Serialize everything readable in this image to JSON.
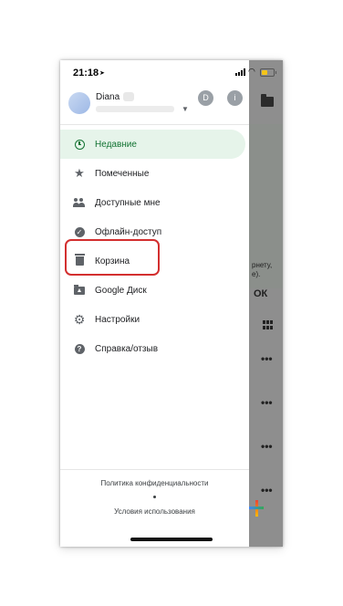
{
  "status_bar": {
    "time": "21:18",
    "location_icon": "location-arrow-icon",
    "signal_icon": "cellular-signal-icon",
    "wifi_icon": "wifi-icon",
    "battery_icon": "battery-icon",
    "battery_level": 0.5
  },
  "account": {
    "name": "Diana",
    "avatar": "avatar",
    "switcher_icon": "chevron-down-icon",
    "chips": [
      "D",
      "i"
    ]
  },
  "menu": {
    "items": [
      {
        "label": "Недавние",
        "icon": "clock-icon",
        "active": true
      },
      {
        "label": "Помеченные",
        "icon": "star-icon"
      },
      {
        "label": "Доступные мне",
        "icon": "people-icon"
      },
      {
        "label": "Офлайн-доступ",
        "icon": "offline-icon"
      },
      {
        "label": "Корзина",
        "icon": "trash-icon",
        "highlighted": true
      },
      {
        "label": "Google Диск",
        "icon": "drive-folder-icon"
      },
      {
        "label": "Настройки",
        "icon": "gear-icon"
      },
      {
        "label": "Справка/отзыв",
        "icon": "help-icon"
      }
    ]
  },
  "footer": {
    "privacy": "Политика конфиденциальности",
    "terms": "Условия использования"
  },
  "background": {
    "partial_text": [
      "рнету,",
      "е)."
    ],
    "ok_label": "ОК"
  },
  "colors": {
    "active_bg": "#e6f4ea",
    "active_text": "#137333",
    "highlight": "#d32f2f",
    "scrim": "#8e8e8e"
  }
}
